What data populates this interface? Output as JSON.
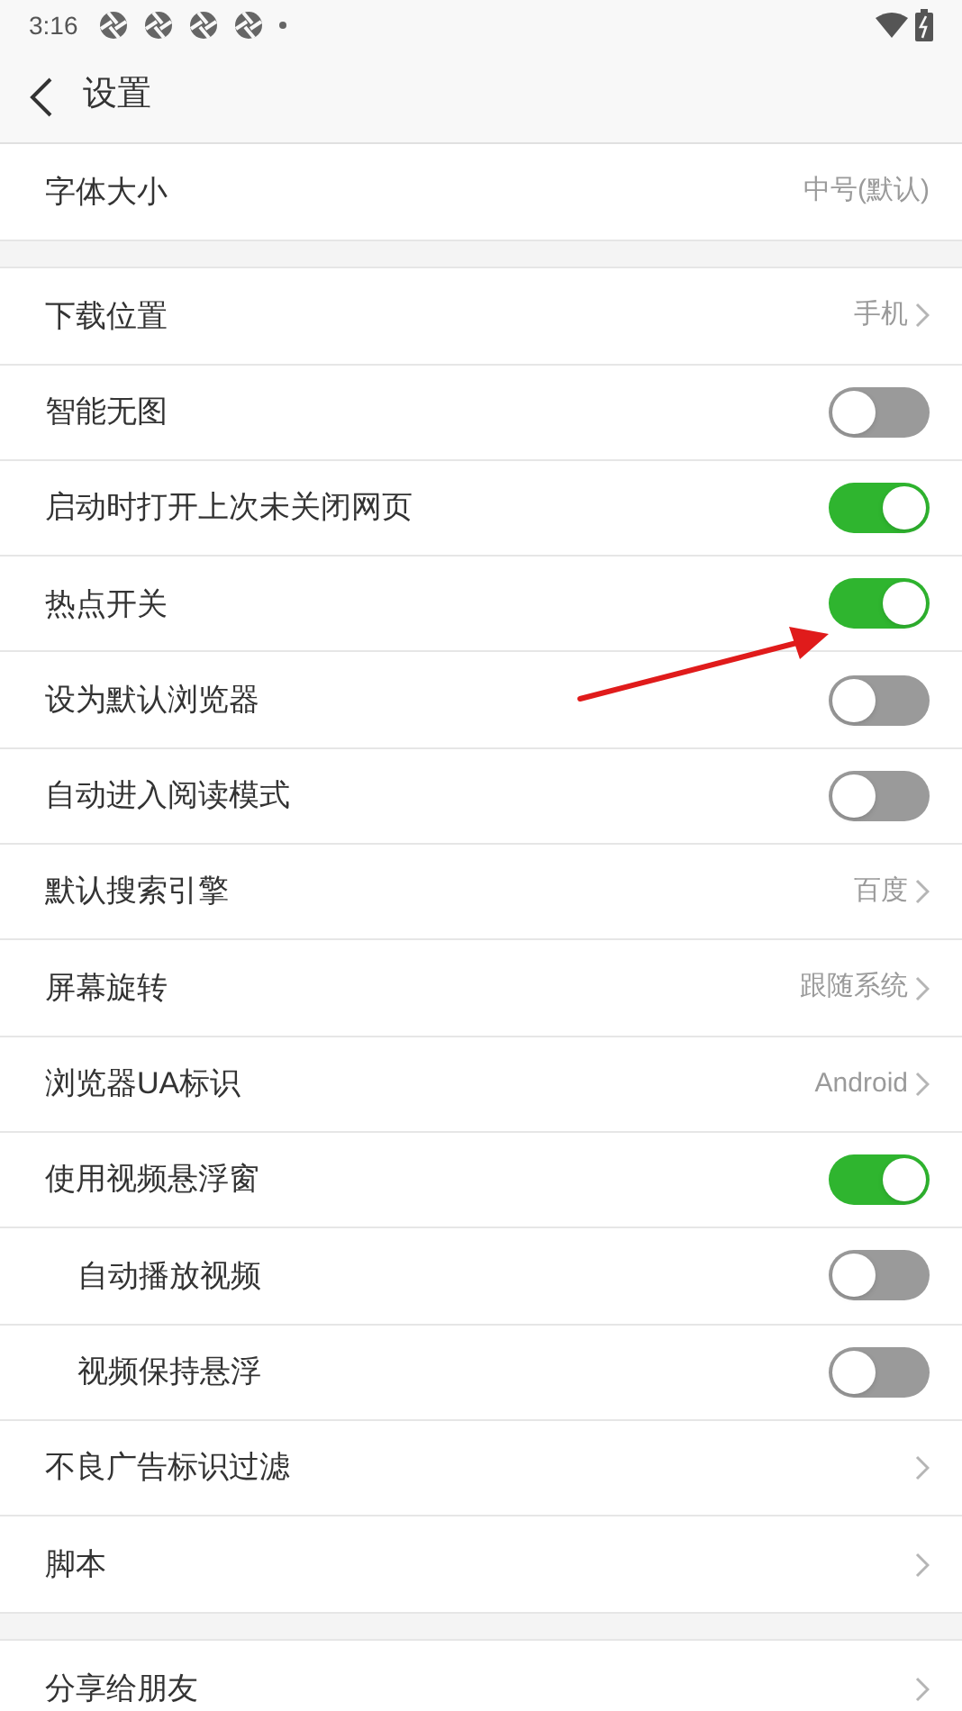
{
  "status_bar": {
    "time": "3:16"
  },
  "header": {
    "title": "设置"
  },
  "groups": [
    {
      "rows": [
        {
          "kind": "value",
          "label": "字体大小",
          "value": "中号(默认)",
          "chevron": false,
          "indented": false
        }
      ]
    },
    {
      "rows": [
        {
          "kind": "value",
          "label": "下载位置",
          "value": "手机",
          "chevron": true,
          "indented": false
        },
        {
          "kind": "toggle",
          "label": "智能无图",
          "on": false,
          "indented": false
        },
        {
          "kind": "toggle",
          "label": "启动时打开上次未关闭网页",
          "on": true,
          "indented": false
        },
        {
          "kind": "toggle",
          "label": "热点开关",
          "on": true,
          "indented": false
        },
        {
          "kind": "toggle",
          "label": "设为默认浏览器",
          "on": false,
          "indented": false
        },
        {
          "kind": "toggle",
          "label": "自动进入阅读模式",
          "on": false,
          "indented": false
        },
        {
          "kind": "value",
          "label": "默认搜索引擎",
          "value": "百度",
          "chevron": true,
          "indented": false
        },
        {
          "kind": "value",
          "label": "屏幕旋转",
          "value": "跟随系统",
          "chevron": true,
          "indented": false
        },
        {
          "kind": "value",
          "label": "浏览器UA标识",
          "value": "Android",
          "chevron": true,
          "indented": false
        },
        {
          "kind": "toggle",
          "label": "使用视频悬浮窗",
          "on": true,
          "indented": false
        },
        {
          "kind": "toggle",
          "label": "自动播放视频",
          "on": false,
          "indented": true
        },
        {
          "kind": "toggle",
          "label": "视频保持悬浮",
          "on": false,
          "indented": true
        },
        {
          "kind": "link",
          "label": "不良广告标识过滤",
          "indented": false
        },
        {
          "kind": "link",
          "label": "脚本",
          "indented": false
        }
      ]
    },
    {
      "rows": [
        {
          "kind": "link",
          "label": "分享给朋友",
          "indented": false
        }
      ]
    }
  ]
}
